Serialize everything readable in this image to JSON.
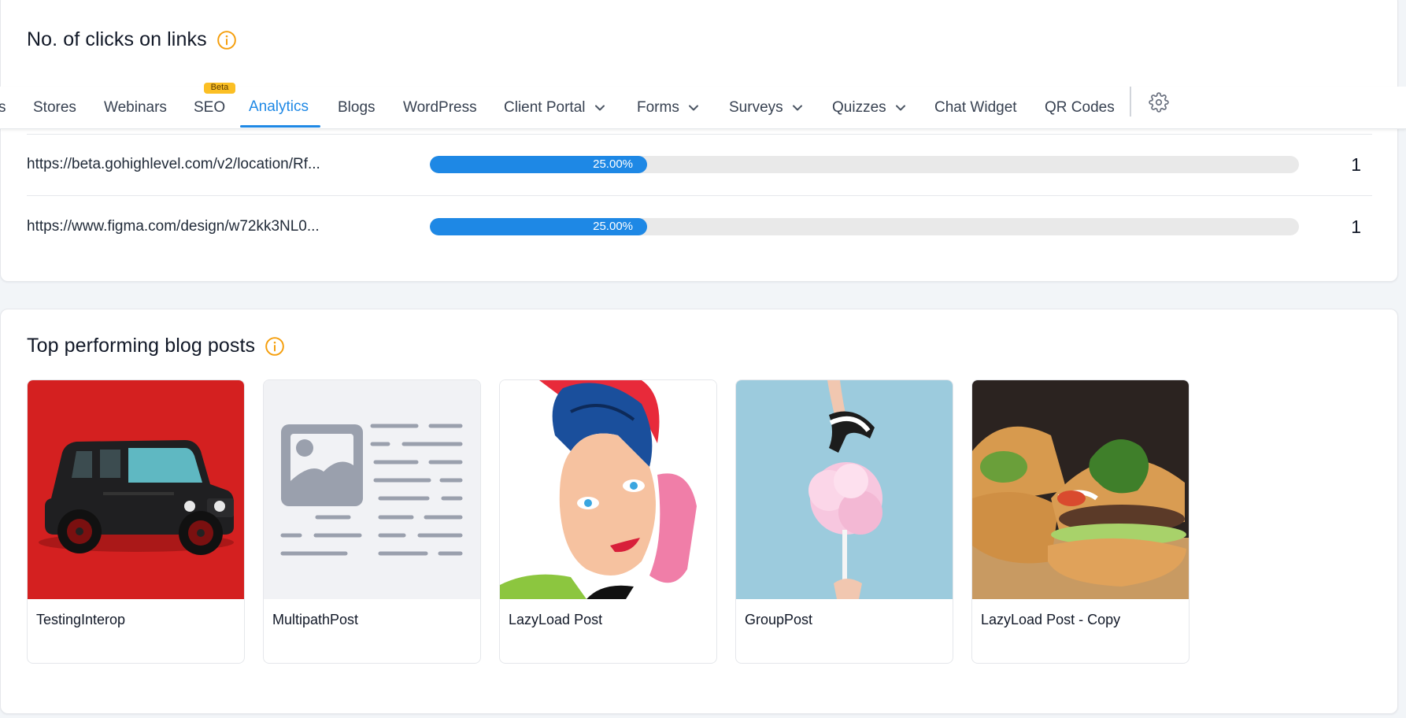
{
  "clicks_section": {
    "title": "No. of clicks on links",
    "info_icon": "info-icon",
    "rows": [
      {
        "url": "https://beta.gohighlevel.com/v2/location/Rf...",
        "percent_label": "25.00%",
        "percent": 25,
        "count": "1"
      },
      {
        "url": "https://www.figma.com/design/w72kk3NL0...",
        "percent_label": "25.00%",
        "percent": 25,
        "count": "1"
      }
    ]
  },
  "nav": {
    "tabs": [
      {
        "label": "s"
      },
      {
        "label": "Stores"
      },
      {
        "label": "Webinars"
      },
      {
        "label": "SEO",
        "badge": "Beta"
      },
      {
        "label": "Analytics",
        "active": true
      },
      {
        "label": "Blogs"
      },
      {
        "label": "WordPress"
      },
      {
        "label": "Client Portal",
        "dropdown": true
      },
      {
        "label": "Forms",
        "dropdown": true
      },
      {
        "label": "Surveys",
        "dropdown": true
      },
      {
        "label": "Quizzes",
        "dropdown": true
      },
      {
        "label": "Chat Widget"
      },
      {
        "label": "QR Codes"
      }
    ],
    "settings_icon": "gear-icon"
  },
  "blog_section": {
    "title": "Top performing blog posts",
    "info_icon": "info-icon",
    "posts": [
      {
        "title": "TestingInterop",
        "thumb": "car-illustration"
      },
      {
        "title": "MultipathPost",
        "thumb": "placeholder-image"
      },
      {
        "title": "LazyLoad Post",
        "thumb": "popart-woman"
      },
      {
        "title": "GroupPost",
        "thumb": "cotton-candy"
      },
      {
        "title": "LazyLoad Post - Copy",
        "thumb": "burger"
      }
    ]
  },
  "colors": {
    "accent": "#1e88e5",
    "info": "#f59e0b",
    "beta_badge": "#fbbf24",
    "page_bg": "#f2f5f8"
  }
}
